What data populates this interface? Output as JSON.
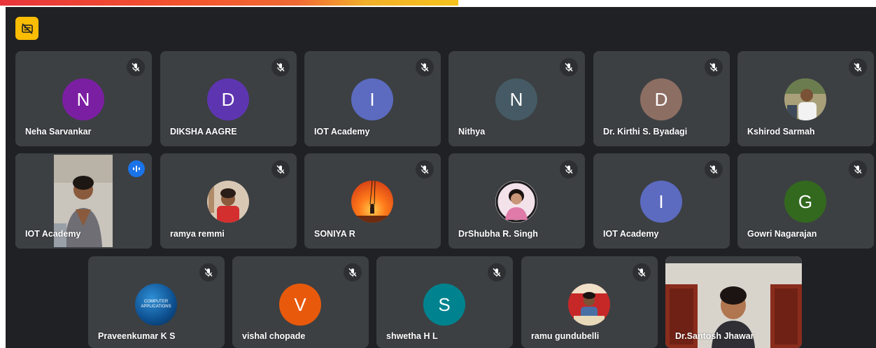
{
  "tiles": [
    {
      "name": "Neha Sarvankar",
      "initial": "N",
      "color": "#7b1fa2",
      "kind": "letter"
    },
    {
      "name": "DIKSHA AAGRE",
      "initial": "D",
      "color": "#5e35b1",
      "kind": "letter"
    },
    {
      "name": "IOT Academy",
      "initial": "I",
      "color": "#5c6bc0",
      "kind": "letter"
    },
    {
      "name": "Nithya",
      "initial": "N",
      "color": "#455a64",
      "kind": "letter"
    },
    {
      "name": "Dr. Kirthi S. Byadagi",
      "initial": "D",
      "color": "#8d6e63",
      "kind": "letter"
    },
    {
      "name": "Kshirod Sarmah",
      "kind": "photo"
    },
    {
      "name": "IOT Academy",
      "kind": "video"
    },
    {
      "name": "ramya remmi",
      "kind": "photo"
    },
    {
      "name": "SONIYA R",
      "kind": "photo"
    },
    {
      "name": "DrShubha R. Singh",
      "kind": "photo"
    },
    {
      "name": "IOT Academy",
      "initial": "I",
      "color": "#5c6bc0",
      "kind": "letter"
    },
    {
      "name": "Gowri Nagarajan",
      "initial": "G",
      "color": "#33691e",
      "kind": "letter"
    },
    {
      "name": "Praveenkumar K S",
      "kind": "photo",
      "logo_text": "COMPUTER APPLICATIONS"
    },
    {
      "name": "vishal chopade",
      "initial": "V",
      "color": "#e8590c",
      "kind": "letter"
    },
    {
      "name": "shwetha H L",
      "initial": "S",
      "color": "#00838f",
      "kind": "letter"
    },
    {
      "name": "ramu gundubelli",
      "kind": "photo"
    },
    {
      "name": "Dr.Santosh Jhawar",
      "kind": "video"
    }
  ],
  "colors": {
    "background": "#202124",
    "tile": "#3c4043",
    "active_border": "#8ab4f8",
    "speaking": "#1a73e8",
    "captions_button": "#fbbc04"
  },
  "icons": {
    "captions": "captions-off-icon",
    "mute": "mic-off-icon",
    "speaking": "speaking-indicator-icon"
  }
}
